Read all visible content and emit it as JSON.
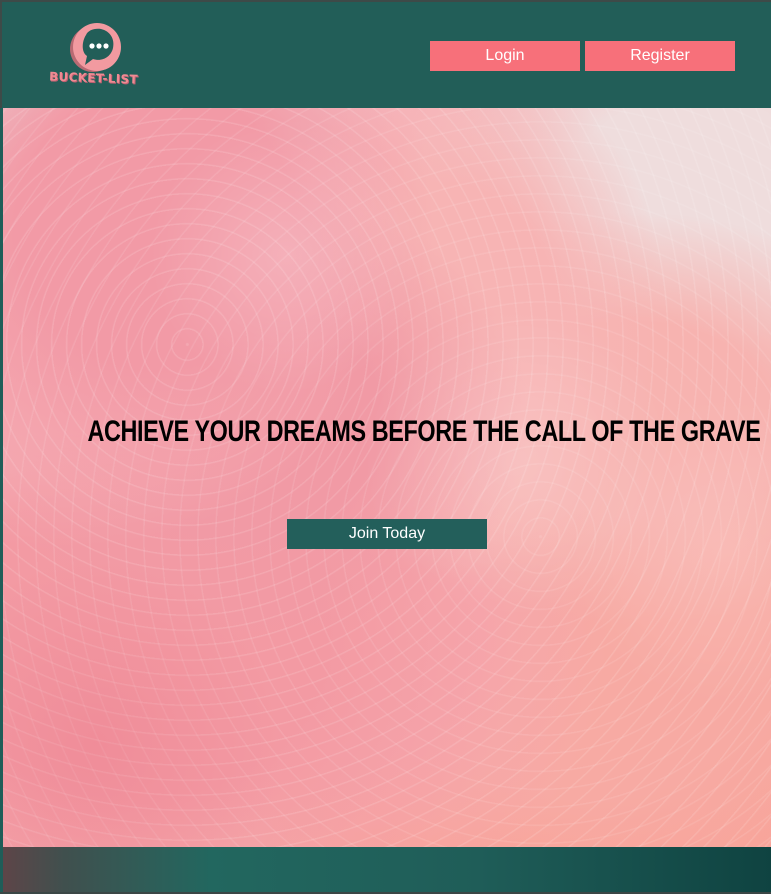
{
  "brand": {
    "name": "BUCKET-LIST",
    "icon": "chat-bubble-icon",
    "color": "#f08b93"
  },
  "header": {
    "login_label": "Login",
    "register_label": "Register",
    "background": "#225e58",
    "button_color": "#f7707a"
  },
  "hero": {
    "headline": "ACHIEVE YOUR DREAMS BEFORE THE CALL OF THE GRAVE",
    "cta_label": "Join Today",
    "image": "pink-smoke-background"
  },
  "footer": {
    "background": "#1f5d58"
  }
}
